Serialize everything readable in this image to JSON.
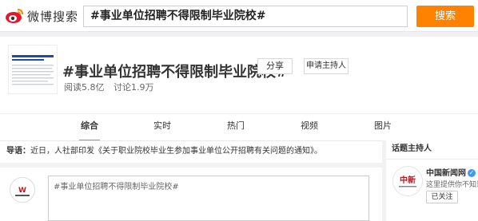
{
  "header": {
    "logo_text": "微博搜索",
    "search_value": "#事业单位招聘不得限制毕业院校#",
    "search_button": "搜索"
  },
  "topic": {
    "title": "#事业单位招聘不得限制毕业院校#",
    "share_label": "分享",
    "apply_host_label": "申请主持人",
    "reads": "阅读5.8亿",
    "discussions": "讨论1.9万"
  },
  "tabs": [
    {
      "label": "综合",
      "active": true
    },
    {
      "label": "实时",
      "active": false
    },
    {
      "label": "热门",
      "active": false
    },
    {
      "label": "视频",
      "active": false
    },
    {
      "label": "图片",
      "active": false
    }
  ],
  "guide": {
    "label": "导语：",
    "text": "近日，人社部印发《关于职业院校毕业生参加事业单位公开招聘有关问题的通知》。"
  },
  "compose": {
    "value": "#事业单位招聘不得限制毕业院校#"
  },
  "sidebar": {
    "title": "话题主持人",
    "host_name": "中国新闻网",
    "host_desc": "这里提供你不知道",
    "follow_label": "已关注"
  },
  "colors": {
    "accent": "#ff8200",
    "verified": "#3d9be9"
  }
}
